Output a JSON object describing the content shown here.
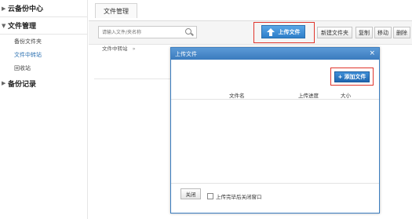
{
  "sidebar": {
    "section1": {
      "label": "云备份中心"
    },
    "section2": {
      "label": "文件管理"
    },
    "items": [
      {
        "label": "备份文件夹"
      },
      {
        "label": "文件中转站"
      },
      {
        "label": "回收站"
      }
    ],
    "section3": {
      "label": "备份记录"
    }
  },
  "tabbar": {
    "active_tab": "文件管理"
  },
  "toolbar": {
    "search_placeholder": "请输入文件/夹名称",
    "upload_label": "上传文件",
    "new_folder_label": "新建文件夹",
    "copy_label": "复制",
    "move_label": "移动",
    "delete_label": "删除"
  },
  "breadcrumb": {
    "label": "文件中转站",
    "arrow": "»"
  },
  "dialog": {
    "title": "上传文件",
    "close_glyph": "×",
    "add_label": "添加文件",
    "add_glyph": "+",
    "columns": {
      "filename": "文件名",
      "progress": "上传进度",
      "size": "大小"
    },
    "footer": {
      "close_label": "关闭",
      "auto_close_label": "上传完毕后关闭窗口",
      "auto_close_checked": false
    }
  },
  "colors": {
    "highlight_red": "#e0352c",
    "dialog_title_blue": "#3a7bbd",
    "button_blue": "#2d7ec9"
  }
}
